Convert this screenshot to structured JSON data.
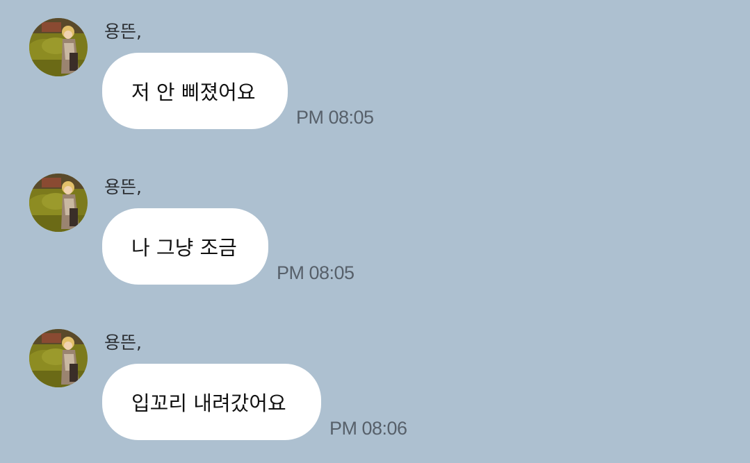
{
  "colors": {
    "background": "#adc0d0",
    "bubble": "#ffffff",
    "time_text": "#57606a"
  },
  "messages": [
    {
      "sender": "용뜬,",
      "text": "저 안 삐졌어요",
      "time": "PM 08:05",
      "avatar_icon": "profile-photo"
    },
    {
      "sender": "용뜬,",
      "text": "나 그냥 조금",
      "time": "PM 08:05",
      "avatar_icon": "profile-photo"
    },
    {
      "sender": "용뜬,",
      "text": "입꼬리 내려갔어요",
      "time": "PM 08:06",
      "avatar_icon": "profile-photo"
    }
  ]
}
